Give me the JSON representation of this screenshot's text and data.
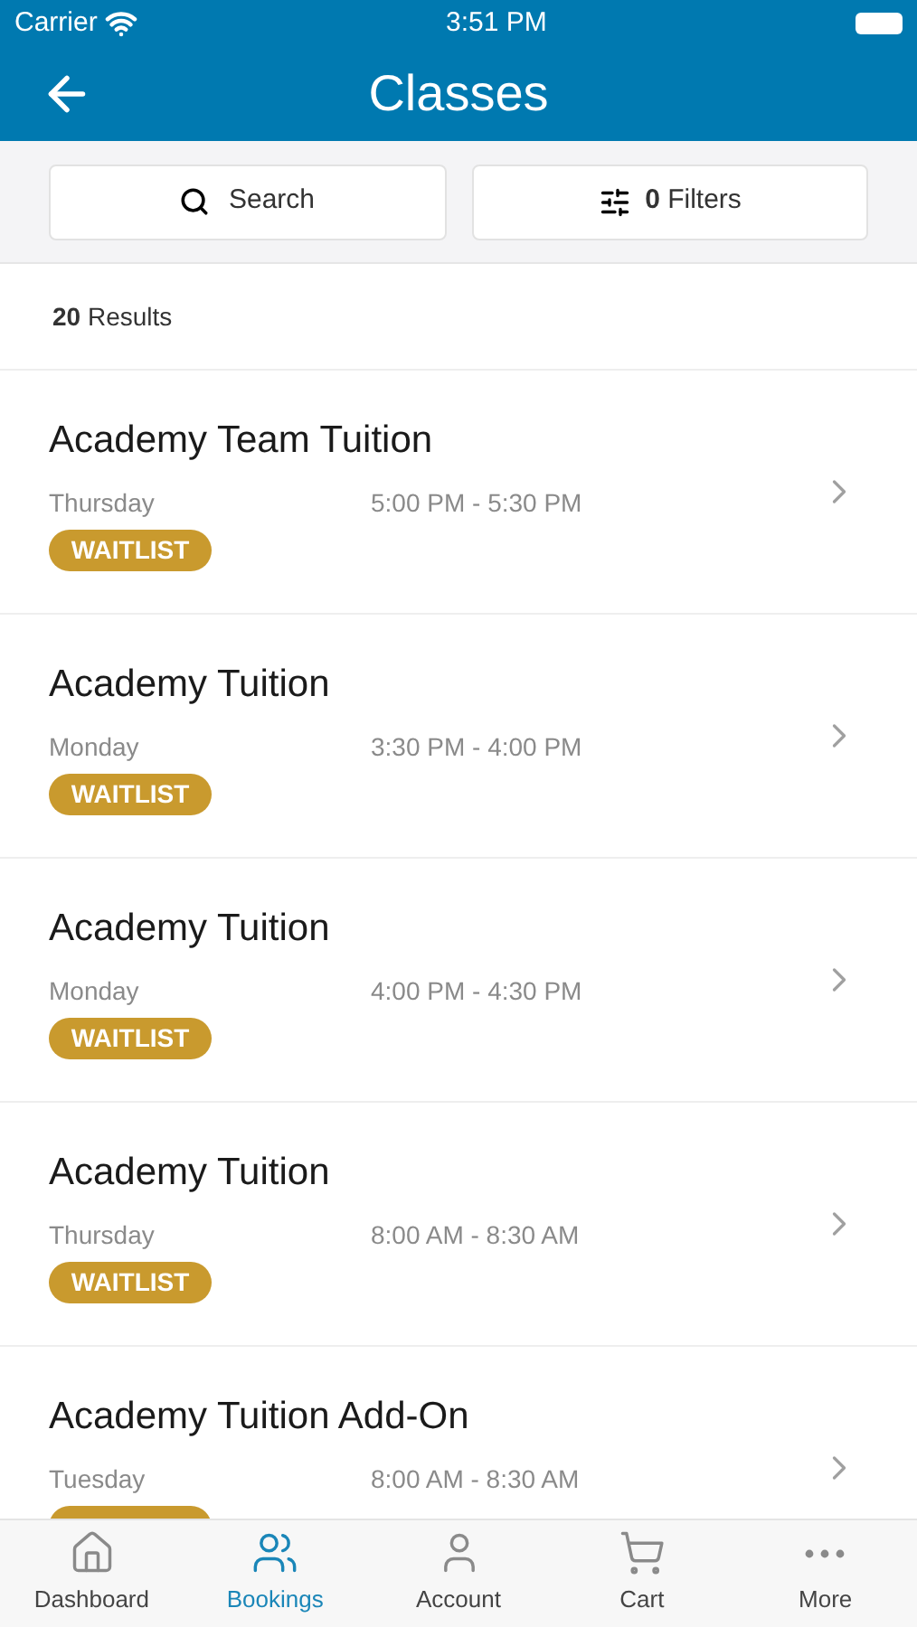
{
  "status_bar": {
    "carrier": "Carrier",
    "time": "3:51 PM"
  },
  "header": {
    "title": "Classes"
  },
  "toolbar": {
    "search": "Search",
    "filters_count": "0",
    "filters_label": "Filters"
  },
  "results": {
    "count": "20",
    "label": "Results"
  },
  "classes": [
    {
      "title": "Academy Team Tuition",
      "day": "Thursday",
      "time": "5:00 PM - 5:30 PM",
      "badge": {
        "kind": "waitlist",
        "label": "WAITLIST"
      }
    },
    {
      "title": "Academy Tuition",
      "day": "Monday",
      "time": "3:30 PM - 4:00 PM",
      "badge": {
        "kind": "waitlist",
        "label": "WAITLIST"
      }
    },
    {
      "title": "Academy Tuition",
      "day": "Monday",
      "time": "4:00 PM - 4:30 PM",
      "badge": {
        "kind": "waitlist",
        "label": "WAITLIST"
      }
    },
    {
      "title": "Academy Tuition",
      "day": "Thursday",
      "time": "8:00 AM - 8:30 AM",
      "badge": {
        "kind": "waitlist",
        "label": "WAITLIST"
      }
    },
    {
      "title": "Academy Tuition Add-On",
      "day": "Tuesday",
      "time": "8:00 AM - 8:30 AM",
      "badge": {
        "kind": "waitlist"
      }
    }
  ],
  "tab_bar": [
    {
      "kind": "home",
      "label": "Dashboard",
      "selected": false
    },
    {
      "kind": "people",
      "label": "Bookings",
      "selected": true
    },
    {
      "kind": "person",
      "label": "Account",
      "selected": false
    },
    {
      "kind": "cart",
      "label": "Cart",
      "selected": false
    },
    {
      "kind": "more",
      "label": "More",
      "selected": false
    }
  ]
}
